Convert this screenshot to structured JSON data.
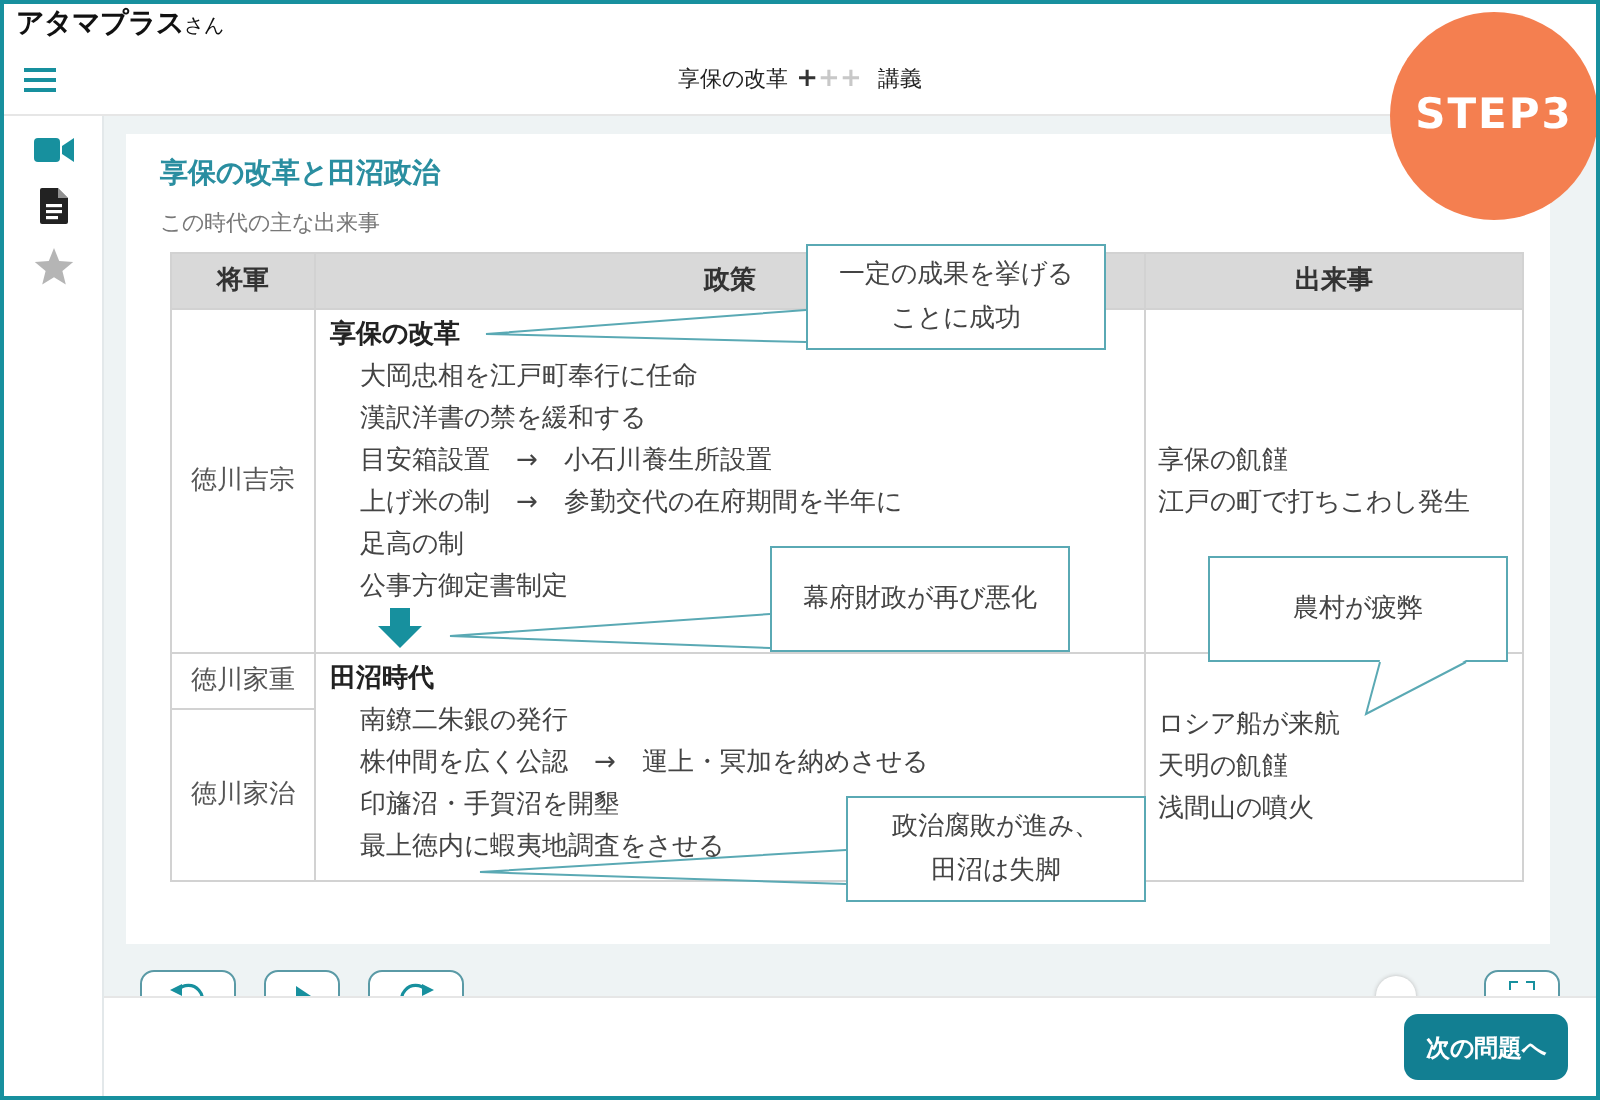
{
  "user": {
    "name": "アタマプラス",
    "suffix": "さん"
  },
  "header": {
    "title": "享保の改革",
    "marks": [
      {
        "text": "+",
        "filled": true
      },
      {
        "text": "+",
        "filled": false
      },
      {
        "text": "+",
        "filled": false
      }
    ],
    "subtitle": "講義"
  },
  "step_badge": "STEP3",
  "sidebar": {
    "items": [
      {
        "kind": "video",
        "selected": true,
        "disabled": false
      },
      {
        "kind": "document",
        "selected": false,
        "disabled": false
      },
      {
        "kind": "star",
        "selected": false,
        "disabled": true
      }
    ]
  },
  "lesson": {
    "title": "享保の改革と田沼政治",
    "caption": "この時代の主な出来事",
    "table": {
      "columns": [
        "将軍",
        "政策",
        "出来事"
      ],
      "sections": [
        {
          "shoguns": [
            "徳川吉宗"
          ],
          "heading": "享保の改革",
          "policies": [
            "大岡忠相を江戸町奉行に任命",
            "漢訳洋書の禁を緩和する",
            "目安箱設置　→　小石川養生所設置",
            "上げ米の制　→　参勤交代の在府期間を半年に",
            "足高の制",
            "公事方御定書制定"
          ],
          "events": [
            "享保の飢饉",
            "江戸の町で打ちこわし発生"
          ],
          "arrow_after": true
        },
        {
          "shoguns": [
            "徳川家重",
            "徳川家治"
          ],
          "heading": "田沼時代",
          "policies": [
            "南鐐二朱銀の発行",
            "株仲間を広く公認　→　運上・冥加を納めさせる",
            "印旛沼・手賀沼を開墾",
            "最上徳内に蝦夷地調査をさせる"
          ],
          "events": [
            "ロシア船が来航",
            "天明の飢饉",
            "浅間山の噴火"
          ],
          "arrow_after": false
        }
      ]
    },
    "callouts": [
      {
        "kind": "box",
        "lines": [
          "一定の成果を挙げる",
          "ことに成功"
        ]
      },
      {
        "kind": "box",
        "lines": [
          "幕府財政が再び悪化"
        ]
      },
      {
        "kind": "bubble",
        "lines": [
          "農村が疲弊"
        ]
      },
      {
        "kind": "box",
        "lines": [
          "政治腐敗が進み、",
          "田沼は失脚"
        ]
      }
    ]
  },
  "next_button": "次の問題へ"
}
